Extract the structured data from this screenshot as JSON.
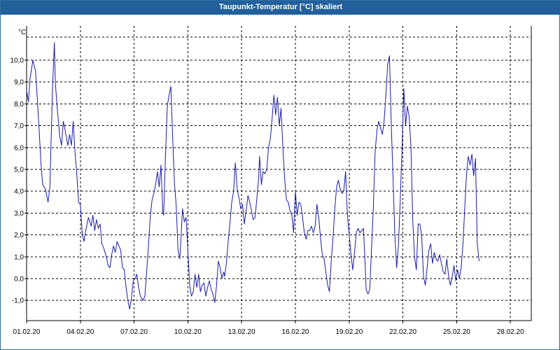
{
  "window": {
    "title": "Taupunkt-Temperatur [°C] skaliert"
  },
  "chart_data": {
    "type": "line",
    "title": "Taupunkt-Temperatur [°C] skaliert",
    "ylabel": "°C",
    "xlabel": "",
    "ylim": [
      -1.8,
      11.4
    ],
    "xlim": [
      0,
      29.2
    ],
    "grid": true,
    "legend": "none",
    "colors": {
      "line": "#1a1aa8",
      "grid": "#000000",
      "axis": "#000000",
      "title_bar": "#22609c"
    },
    "y_ticks": [
      {
        "value": -1,
        "label": "-1,0"
      },
      {
        "value": 0,
        "label": "0,0"
      },
      {
        "value": 1,
        "label": "1,0"
      },
      {
        "value": 2,
        "label": "2,0"
      },
      {
        "value": 3,
        "label": "3,0"
      },
      {
        "value": 4,
        "label": "4,0"
      },
      {
        "value": 5,
        "label": "5,0"
      },
      {
        "value": 6,
        "label": "6,0"
      },
      {
        "value": 7,
        "label": "7,0"
      },
      {
        "value": 8,
        "label": "8,0"
      },
      {
        "value": 9,
        "label": "9,0"
      },
      {
        "value": 10,
        "label": "10,0"
      }
    ],
    "x_ticks": [
      {
        "value": 0,
        "label": "01.02.20"
      },
      {
        "value": 3,
        "label": "04.02.20"
      },
      {
        "value": 6,
        "label": "07.02.20"
      },
      {
        "value": 9,
        "label": "10.02.20"
      },
      {
        "value": 12,
        "label": "13.02.20"
      },
      {
        "value": 15,
        "label": "16.02.20"
      },
      {
        "value": 18,
        "label": "19.02.20"
      },
      {
        "value": 21,
        "label": "22.02.20"
      },
      {
        "value": 24,
        "label": "25.02.20"
      },
      {
        "value": 27,
        "label": "28.02.20"
      }
    ],
    "series": [
      {
        "points": [
          [
            0.0,
            8.6
          ],
          [
            0.1,
            8.1
          ],
          [
            0.2,
            9.2
          ],
          [
            0.35,
            10.0
          ],
          [
            0.5,
            9.5
          ],
          [
            0.6,
            8.2
          ],
          [
            0.7,
            6.8
          ],
          [
            0.8,
            5.3
          ],
          [
            0.9,
            4.3
          ],
          [
            1.05,
            4.1
          ],
          [
            1.2,
            3.5
          ],
          [
            1.3,
            4.2
          ],
          [
            1.45,
            8.8
          ],
          [
            1.55,
            10.8
          ],
          [
            1.6,
            9.0
          ],
          [
            1.7,
            7.9
          ],
          [
            1.85,
            6.5
          ],
          [
            1.95,
            6.1
          ],
          [
            2.05,
            7.2
          ],
          [
            2.15,
            6.8
          ],
          [
            2.3,
            6.1
          ],
          [
            2.4,
            6.6
          ],
          [
            2.5,
            6.1
          ],
          [
            2.6,
            7.2
          ],
          [
            2.7,
            5.8
          ],
          [
            2.8,
            4.8
          ],
          [
            2.9,
            3.5
          ],
          [
            3.0,
            3.4
          ],
          [
            3.1,
            2.1
          ],
          [
            3.2,
            1.7
          ],
          [
            3.3,
            2.2
          ],
          [
            3.45,
            2.8
          ],
          [
            3.6,
            2.4
          ],
          [
            3.7,
            2.9
          ],
          [
            3.8,
            2.2
          ],
          [
            3.9,
            2.7
          ],
          [
            4.0,
            2.3
          ],
          [
            4.1,
            2.5
          ],
          [
            4.2,
            1.6
          ],
          [
            4.3,
            1.4
          ],
          [
            4.45,
            1.0
          ],
          [
            4.55,
            0.6
          ],
          [
            4.65,
            0.5
          ],
          [
            4.75,
            1.1
          ],
          [
            4.85,
            1.5
          ],
          [
            4.95,
            1.2
          ],
          [
            5.05,
            1.7
          ],
          [
            5.15,
            1.5
          ],
          [
            5.25,
            1.3
          ],
          [
            5.35,
            0.5
          ],
          [
            5.45,
            0.4
          ],
          [
            5.55,
            -0.4
          ],
          [
            5.65,
            -1.0
          ],
          [
            5.75,
            -1.4
          ],
          [
            5.85,
            -0.9
          ],
          [
            5.95,
            -0.1
          ],
          [
            6.05,
            0.0
          ],
          [
            6.15,
            0.2
          ],
          [
            6.25,
            -0.4
          ],
          [
            6.35,
            -0.8
          ],
          [
            6.5,
            -1.0
          ],
          [
            6.6,
            -0.8
          ],
          [
            6.7,
            0.3
          ],
          [
            6.8,
            1.5
          ],
          [
            6.9,
            2.8
          ],
          [
            7.0,
            3.6
          ],
          [
            7.1,
            3.9
          ],
          [
            7.2,
            4.3
          ],
          [
            7.3,
            4.9
          ],
          [
            7.4,
            4.2
          ],
          [
            7.5,
            5.2
          ],
          [
            7.6,
            3.0
          ],
          [
            7.65,
            2.9
          ],
          [
            7.75,
            5.6
          ],
          [
            7.85,
            7.9
          ],
          [
            7.95,
            8.4
          ],
          [
            8.05,
            8.8
          ],
          [
            8.15,
            6.5
          ],
          [
            8.25,
            4.4
          ],
          [
            8.35,
            3.3
          ],
          [
            8.45,
            1.3
          ],
          [
            8.55,
            0.9
          ],
          [
            8.6,
            1.6
          ],
          [
            8.7,
            3.2
          ],
          [
            8.8,
            2.6
          ],
          [
            8.9,
            2.8
          ],
          [
            9.0,
            1.3
          ],
          [
            9.1,
            -0.3
          ],
          [
            9.2,
            -0.8
          ],
          [
            9.3,
            -0.6
          ],
          [
            9.4,
            0.2
          ],
          [
            9.5,
            -0.4
          ],
          [
            9.6,
            0.2
          ],
          [
            9.7,
            -0.6
          ],
          [
            9.8,
            -0.3
          ],
          [
            9.9,
            -0.2
          ],
          [
            10.0,
            -0.8
          ],
          [
            10.1,
            -0.4
          ],
          [
            10.2,
            -0.1
          ],
          [
            10.3,
            -0.5
          ],
          [
            10.4,
            -0.7
          ],
          [
            10.5,
            -1.1
          ],
          [
            10.6,
            -0.3
          ],
          [
            10.7,
            0.8
          ],
          [
            10.8,
            0.5
          ],
          [
            10.9,
            0.0
          ],
          [
            11.0,
            0.3
          ],
          [
            11.05,
            0.1
          ],
          [
            11.15,
            0.7
          ],
          [
            11.25,
            1.7
          ],
          [
            11.35,
            2.6
          ],
          [
            11.45,
            3.5
          ],
          [
            11.55,
            4.0
          ],
          [
            11.65,
            5.3
          ],
          [
            11.75,
            4.1
          ],
          [
            11.85,
            3.7
          ],
          [
            11.95,
            3.2
          ],
          [
            12.05,
            3.4
          ],
          [
            12.15,
            2.5
          ],
          [
            12.25,
            3.1
          ],
          [
            12.35,
            3.8
          ],
          [
            12.45,
            3.5
          ],
          [
            12.55,
            3.1
          ],
          [
            12.65,
            2.7
          ],
          [
            12.75,
            2.8
          ],
          [
            12.85,
            3.7
          ],
          [
            12.95,
            4.6
          ],
          [
            13.0,
            5.6
          ],
          [
            13.1,
            4.3
          ],
          [
            13.2,
            4.9
          ],
          [
            13.3,
            4.8
          ],
          [
            13.4,
            5.0
          ],
          [
            13.5,
            6.0
          ],
          [
            13.6,
            6.4
          ],
          [
            13.7,
            7.3
          ],
          [
            13.8,
            8.4
          ],
          [
            13.9,
            7.5
          ],
          [
            14.0,
            8.3
          ],
          [
            14.1,
            7.0
          ],
          [
            14.2,
            7.8
          ],
          [
            14.3,
            6.0
          ],
          [
            14.4,
            4.6
          ],
          [
            14.5,
            3.6
          ],
          [
            14.6,
            3.5
          ],
          [
            14.7,
            3.1
          ],
          [
            14.8,
            2.9
          ],
          [
            14.9,
            2.1
          ],
          [
            15.0,
            4.0
          ],
          [
            15.1,
            2.9
          ],
          [
            15.2,
            3.5
          ],
          [
            15.3,
            3.4
          ],
          [
            15.4,
            2.8
          ],
          [
            15.5,
            2.1
          ],
          [
            15.6,
            1.8
          ],
          [
            15.7,
            2.2
          ],
          [
            15.8,
            2.2
          ],
          [
            15.9,
            2.4
          ],
          [
            16.0,
            2.1
          ],
          [
            16.1,
            2.4
          ],
          [
            16.2,
            3.4
          ],
          [
            16.3,
            2.8
          ],
          [
            16.4,
            1.9
          ],
          [
            16.5,
            1.1
          ],
          [
            16.6,
            0.9
          ],
          [
            16.7,
            0.3
          ],
          [
            16.8,
            -0.3
          ],
          [
            16.9,
            -0.6
          ],
          [
            17.0,
            0.8
          ],
          [
            17.1,
            1.9
          ],
          [
            17.2,
            3.2
          ],
          [
            17.3,
            4.2
          ],
          [
            17.4,
            4.5
          ],
          [
            17.5,
            4.1
          ],
          [
            17.6,
            3.9
          ],
          [
            17.7,
            4.0
          ],
          [
            17.8,
            4.9
          ],
          [
            17.9,
            3.0
          ],
          [
            18.0,
            2.0
          ],
          [
            18.1,
            1.1
          ],
          [
            18.2,
            0.4
          ],
          [
            18.3,
            1.2
          ],
          [
            18.4,
            2.1
          ],
          [
            18.5,
            2.3
          ],
          [
            18.6,
            2.1
          ],
          [
            18.7,
            2.2
          ],
          [
            18.8,
            2.3
          ],
          [
            18.9,
            0.5
          ],
          [
            18.95,
            -0.5
          ],
          [
            19.05,
            -0.7
          ],
          [
            19.15,
            -0.5
          ],
          [
            19.25,
            1.4
          ],
          [
            19.35,
            3.3
          ],
          [
            19.45,
            5.8
          ],
          [
            19.55,
            6.8
          ],
          [
            19.65,
            7.2
          ],
          [
            19.75,
            6.9
          ],
          [
            19.85,
            6.6
          ],
          [
            19.95,
            7.2
          ],
          [
            20.05,
            8.4
          ],
          [
            20.15,
            9.8
          ],
          [
            20.25,
            10.2
          ],
          [
            20.35,
            7.0
          ],
          [
            20.45,
            4.6
          ],
          [
            20.55,
            2.0
          ],
          [
            20.65,
            0.5
          ],
          [
            20.75,
            1.5
          ],
          [
            20.85,
            3.6
          ],
          [
            20.95,
            5.9
          ],
          [
            21.05,
            8.7
          ],
          [
            21.15,
            7.0
          ],
          [
            21.25,
            7.9
          ],
          [
            21.35,
            7.4
          ],
          [
            21.45,
            6.0
          ],
          [
            21.55,
            2.6
          ],
          [
            21.65,
            1.0
          ],
          [
            21.75,
            0.4
          ],
          [
            21.85,
            2.5
          ],
          [
            21.95,
            2.5
          ],
          [
            22.05,
            1.9
          ],
          [
            22.15,
            0.1
          ],
          [
            22.25,
            -0.3
          ],
          [
            22.35,
            0.5
          ],
          [
            22.45,
            1.3
          ],
          [
            22.55,
            1.6
          ],
          [
            22.65,
            0.7
          ],
          [
            22.75,
            1.2
          ],
          [
            22.85,
            0.9
          ],
          [
            22.95,
            0.8
          ],
          [
            23.05,
            1.1
          ],
          [
            23.15,
            0.7
          ],
          [
            23.25,
            0.3
          ],
          [
            23.35,
            0.2
          ],
          [
            23.45,
            0.9
          ],
          [
            23.55,
            0.1
          ],
          [
            23.65,
            -0.3
          ],
          [
            23.75,
            0.1
          ],
          [
            23.85,
            0.6
          ],
          [
            23.95,
            -0.1
          ],
          [
            24.05,
            0.4
          ],
          [
            24.15,
            0.0
          ],
          [
            24.25,
            0.5
          ],
          [
            24.35,
            1.6
          ],
          [
            24.45,
            3.2
          ],
          [
            24.55,
            4.8
          ],
          [
            24.65,
            5.6
          ],
          [
            24.75,
            5.2
          ],
          [
            24.85,
            5.7
          ],
          [
            24.95,
            4.7
          ],
          [
            25.05,
            5.5
          ],
          [
            25.15,
            1.6
          ],
          [
            25.25,
            0.8
          ]
        ]
      }
    ]
  }
}
